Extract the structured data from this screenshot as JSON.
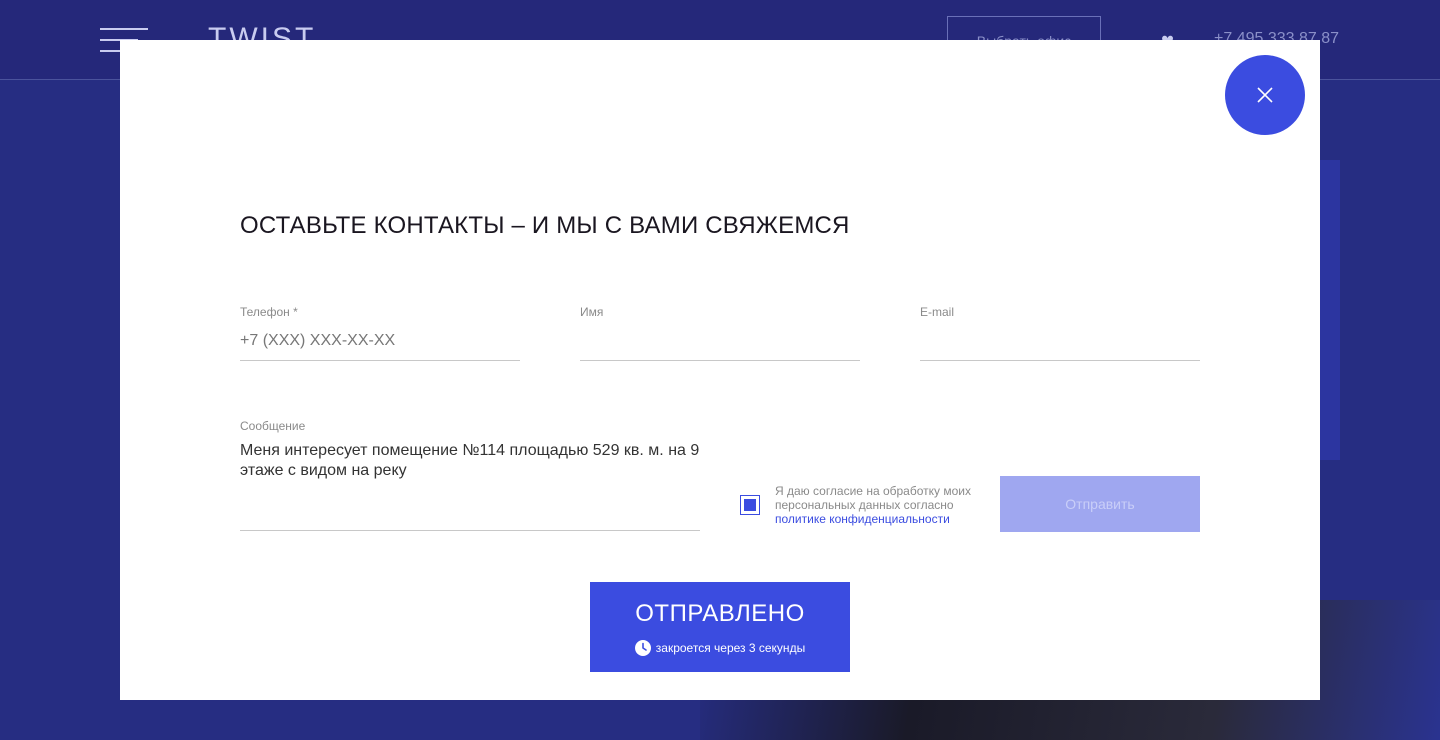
{
  "background": {
    "logo": "TWIST",
    "office_button": "Выбрать офис",
    "phone": "+7 495 333 87 87",
    "heart_icon": "heart-icon",
    "menu_icon": "burger-menu-icon"
  },
  "modal": {
    "close_icon": "close-icon",
    "title": "ОСТАВЬТЕ КОНТАКТЫ – И МЫ С ВАМИ СВЯЖЕМСЯ",
    "fields": {
      "phone": {
        "label": "Телефон *",
        "placeholder": "+7 (XXX) XXX-XX-XX",
        "value": ""
      },
      "name": {
        "label": "Имя",
        "placeholder": "",
        "value": ""
      },
      "email": {
        "label": "E-mail",
        "placeholder": "",
        "value": ""
      },
      "message": {
        "label": "Сообщение",
        "value": "Меня интересует помещение №114 площадью 529 кв. м. на 9 этаже с видом на реку"
      }
    },
    "consent": {
      "checked": true,
      "text": "Я даю согласие на обработку моих персональных данных согласно ",
      "link_text": "политике конфиденциальности"
    },
    "submit_label": "Отправить",
    "sent": {
      "title": "ОТПРАВЛЕНО",
      "subtitle": "закроется через 3 секунды",
      "clock_icon": "clock-icon"
    }
  },
  "colors": {
    "accent": "#3b4ce0",
    "background": "#262d82",
    "submit_disabled": "#9fa7f0"
  }
}
